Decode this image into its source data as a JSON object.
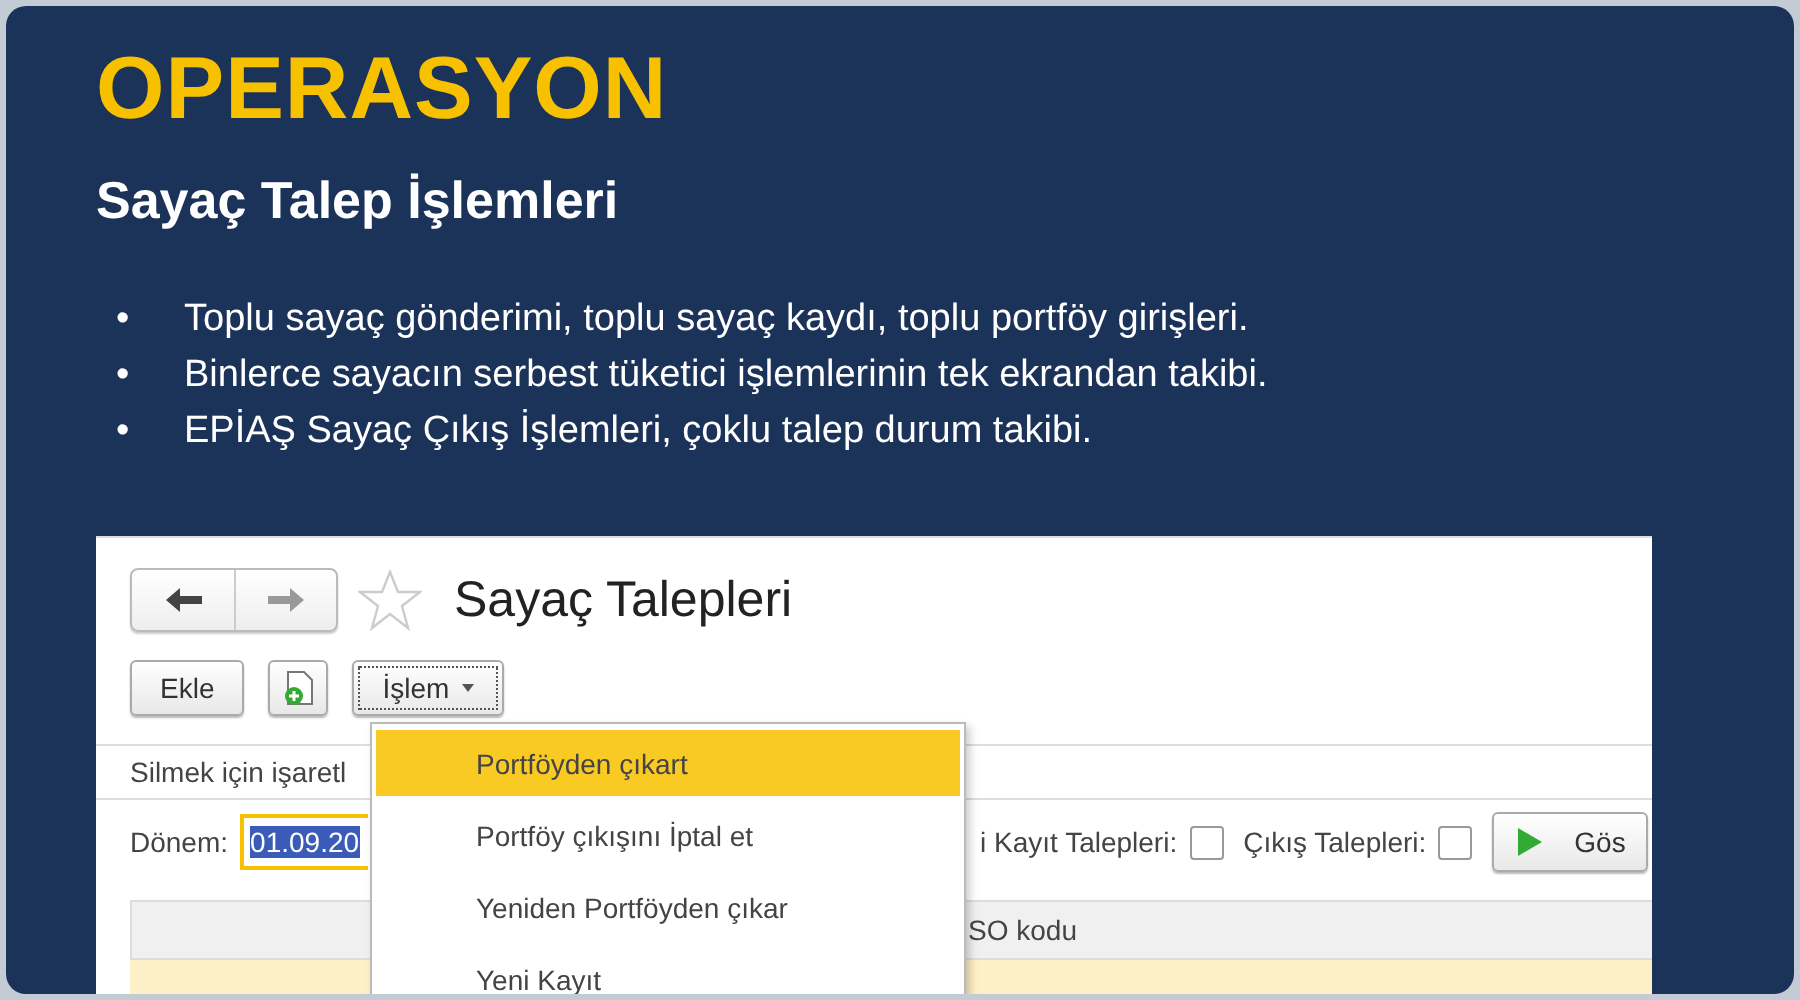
{
  "slide": {
    "heading": "OPERASYON",
    "subtitle": "Sayaç Talep İşlemleri",
    "bullets": [
      {
        "marker": "•",
        "text": "Toplu sayaç gönderimi, toplu sayaç kaydı, toplu portföy girişleri."
      },
      {
        "marker": "•",
        "text": "Binlerce sayacın serbest tüketici işlemlerinin tek ekrandan takibi."
      },
      {
        "marker": "•",
        "text": "EPİAŞ Sayaç Çıkış İşlemleri, çoklu talep durum takibi."
      }
    ]
  },
  "screen": {
    "title": "Sayaç Talepleri",
    "add_button": "Ekle",
    "action_button": "İşlem",
    "hint": "Silmek için işaretl",
    "filters": {
      "period_label": "Dönem:",
      "period_value": "01.09.20",
      "checkboxes": [
        {
          "label": "i Kayıt Talepleri:",
          "checked": false
        },
        {
          "label": "Çıkış Talepleri:",
          "checked": false
        }
      ],
      "show_button": "Gös"
    },
    "table": {
      "columns": [
        "SO kodu"
      ]
    },
    "menu": {
      "items": [
        {
          "label": "Portföyden çıkart",
          "selected": true
        },
        {
          "label": "Portföy çıkışını İptal et",
          "selected": false
        },
        {
          "label": "Yeniden Portföyden çıkar",
          "selected": false
        },
        {
          "label": "Yeni Kayıt",
          "selected": false
        }
      ]
    }
  }
}
